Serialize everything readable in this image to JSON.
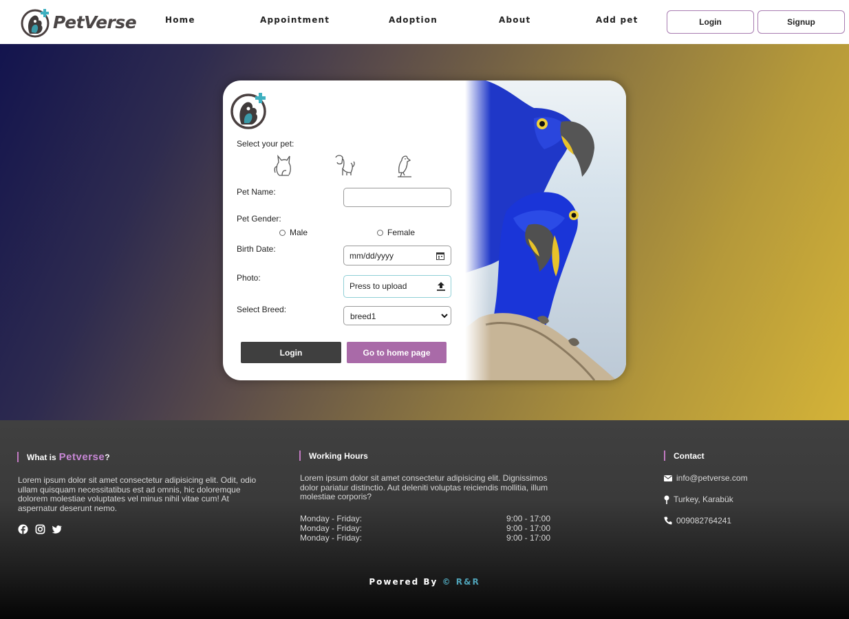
{
  "nav": {
    "brand": "PetVerse",
    "links": [
      "Home",
      "Appointment",
      "Adoption",
      "About",
      "Add pet"
    ],
    "login": "Login",
    "signup": "Signup"
  },
  "form": {
    "select_pet_label": "Select your pet:",
    "pet_options": [
      "cat-icon",
      "dog-icon",
      "bird-icon"
    ],
    "pet_name_label": "Pet Name:",
    "pet_name_value": "",
    "gender_label": "Pet Gender:",
    "gender_options": [
      "Male",
      "Female"
    ],
    "birth_label": "Birth Date:",
    "birth_placeholder": "mm/dd/yyyy",
    "photo_label": "Photo:",
    "photo_placeholder": "Press to upload",
    "breed_label": "Select Breed:",
    "breed_selected": "breed1",
    "login_button": "Login",
    "home_button": "Go to home page"
  },
  "footer": {
    "about": {
      "heading_prefix": "What is",
      "heading_brand": "Petverse",
      "heading_suffix": "?",
      "text": "Lorem ipsum dolor sit amet consectetur adipisicing elit. Odit, odio ullam quisquam necessitatibus est ad omnis, hic doloremque dolorem molestiae voluptates vel minus nihil vitae cum! At aspernatur deserunt nemo."
    },
    "social": [
      "facebook-icon",
      "instagram-icon",
      "twitter-icon"
    ],
    "hours": {
      "heading": "Working Hours",
      "text": "Lorem ipsum dolor sit amet consectetur adipisicing elit. Dignissimos dolor pariatur distinctio. Aut deleniti voluptas reiciendis mollitia, illum molestiae corporis?",
      "rows": [
        {
          "day": "Monday - Friday:",
          "time": "9:00 - 17:00"
        },
        {
          "day": "Monday - Friday:",
          "time": "9:00 - 17:00"
        },
        {
          "day": "Monday - Friday:",
          "time": "9:00 - 17:00"
        }
      ]
    },
    "contact": {
      "heading": "Contact",
      "email": "info@petverse.com",
      "location": "Turkey, Karabük",
      "phone": "009082764241"
    },
    "powered_prefix": "Powered By",
    "powered_brand": "© R&R"
  },
  "colors": {
    "accent_purple": "#a96aa8",
    "dark_button": "#3f3f3f",
    "footer_accent": "#c888d6",
    "credit_blue": "#4fa3b8"
  }
}
